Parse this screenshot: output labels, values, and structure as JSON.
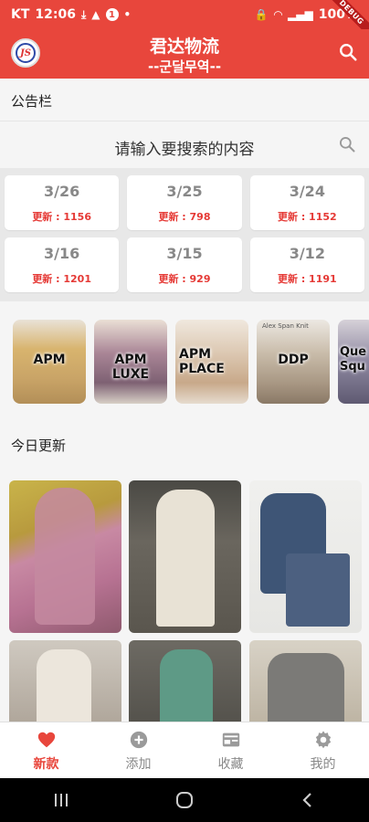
{
  "status_bar": {
    "carrier": "KT",
    "time": "12:06",
    "notification_count": "1",
    "battery": "100%",
    "debug": "DEBUG"
  },
  "app": {
    "title": "君达物流",
    "subtitle": "--군달무역--",
    "logo_text": "JS"
  },
  "notice": {
    "title": "公告栏"
  },
  "search": {
    "placeholder": "请输入要搜索的内容"
  },
  "dates": [
    {
      "date": "3/26",
      "update": "更新 : 1156"
    },
    {
      "date": "3/25",
      "update": "更新 : 798"
    },
    {
      "date": "3/24",
      "update": "更新 : 1152"
    },
    {
      "date": "3/16",
      "update": "更新 : 1201"
    },
    {
      "date": "3/15",
      "update": "更新 : 929"
    },
    {
      "date": "3/12",
      "update": "更新 : 1191"
    }
  ],
  "brands": [
    {
      "name": "APM",
      "bg": "#c9a467"
    },
    {
      "name": "APM LUXE",
      "bg": "#8a6f7c"
    },
    {
      "name": "APM PLACE",
      "bg": "#d4c2ae"
    },
    {
      "name": "DDP",
      "bg": "#b9ad9c",
      "tag": "Alex Span Knit"
    },
    {
      "name": "Que Squ",
      "bg": "#7a7388"
    }
  ],
  "today": {
    "title": "今日更新"
  },
  "bottom_nav": [
    {
      "label": "新款",
      "icon": "heart-icon",
      "active": true
    },
    {
      "label": "添加",
      "icon": "plus-circle-icon",
      "active": false
    },
    {
      "label": "收藏",
      "icon": "favorites-card-icon",
      "active": false
    },
    {
      "label": "我的",
      "icon": "gear-icon",
      "active": false
    }
  ],
  "colors": {
    "accent": "#e8463c",
    "update_red": "#e53935"
  }
}
